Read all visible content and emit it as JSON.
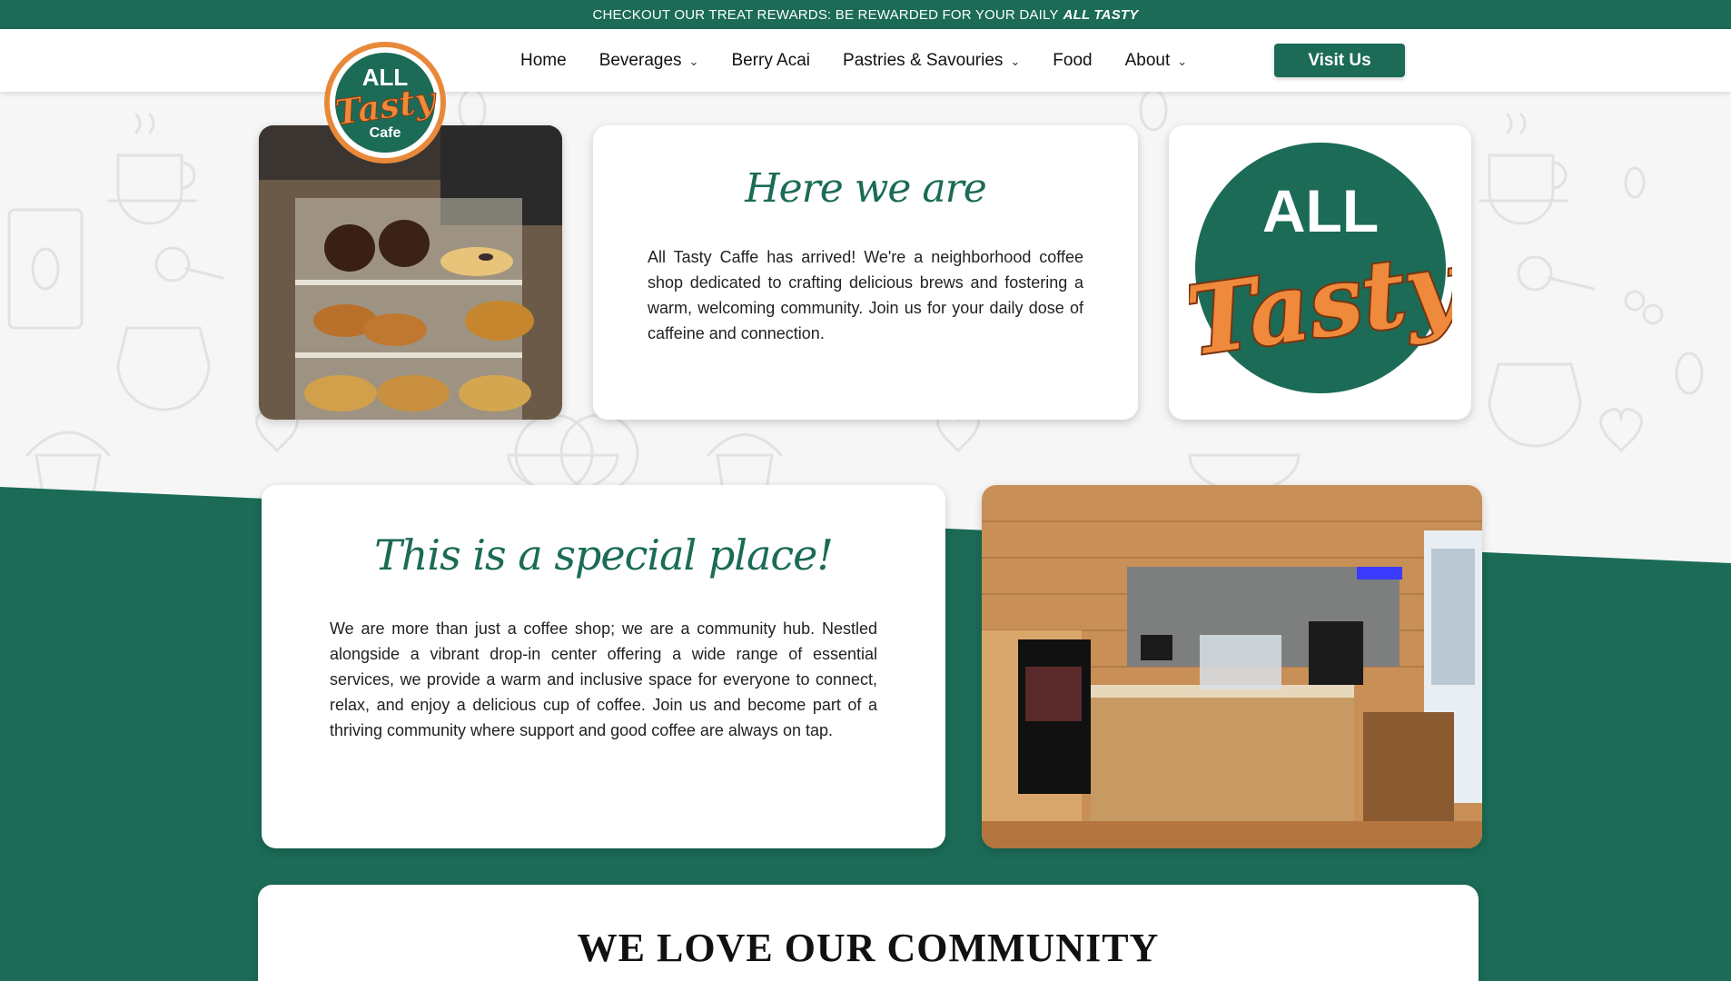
{
  "announcement": {
    "text": "CHECKOUT OUR TREAT REWARDS: BE REWARDED FOR YOUR DAILY",
    "emphasis": "ALL TASTY"
  },
  "logo": {
    "line1": "ALL",
    "line2": "Tasty",
    "line3": "Cafe"
  },
  "nav": {
    "items": [
      {
        "label": "Home",
        "has_dropdown": false
      },
      {
        "label": "Beverages",
        "has_dropdown": true
      },
      {
        "label": "Berry Acai",
        "has_dropdown": false
      },
      {
        "label": "Pastries & Savouries",
        "has_dropdown": true
      },
      {
        "label": "Food",
        "has_dropdown": false
      },
      {
        "label": "About",
        "has_dropdown": true
      }
    ],
    "cta": "Visit Us"
  },
  "here": {
    "title": "Here we are",
    "body": "All Tasty Caffe has arrived! We're a neighborhood coffee shop dedicated to crafting delicious brews and fostering a warm, welcoming community. Join us for your daily dose of caffeine and connection."
  },
  "special": {
    "title": "This is a special place!",
    "body": "We are more than just a coffee shop; we are a community hub. Nestled alongside a vibrant drop-in center offering a wide range of essential services, we provide a warm and inclusive space for everyone to connect, relax, and enjoy a delicious cup of coffee. Join us and become part of a thriving community where support and good coffee are always on tap."
  },
  "community": {
    "title": "WE LOVE OUR COMMUNITY"
  },
  "colors": {
    "brand_green": "#1b6b57",
    "brand_orange": "#ef8a3c",
    "background": "#f6f6f6"
  }
}
